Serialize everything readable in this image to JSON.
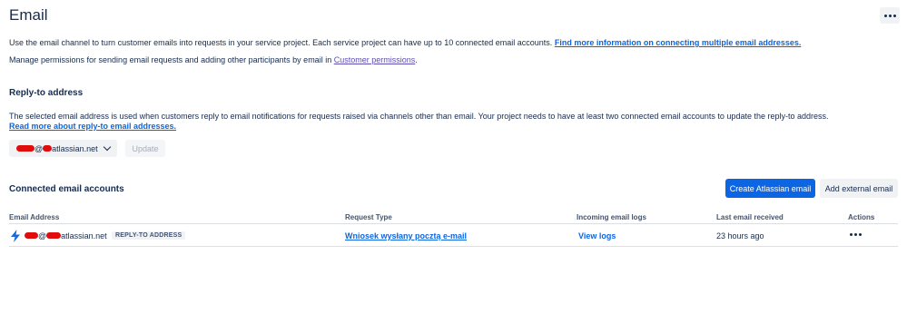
{
  "header": {
    "title": "Email"
  },
  "intro": {
    "line1_text": "Use the email channel to turn customer emails into requests in your service project. Each service project can have up to 10 connected email accounts.",
    "line1_link": "Find more information on connecting multiple email addresses.",
    "line2_text": "Manage permissions for sending email requests and adding other participants by email in",
    "line2_link": "Customer permissions",
    "line2_end": "."
  },
  "reply_to": {
    "heading": "Reply-to address",
    "description": "The selected email address is used when customers reply to email notifications for requests raised via channels other than email. Your project needs to have at least two connected email accounts to update the reply-to address.",
    "learn_more": "Read more about reply-to email addresses.",
    "selected_email_visible": "atlassian.net",
    "at_sign": "@",
    "update_label": "Update"
  },
  "accounts": {
    "heading": "Connected email accounts",
    "create_label": "Create Atlassian email",
    "add_external_label": "Add external email",
    "columns": [
      "Email Address",
      "Request Type",
      "Incoming email logs",
      "Last email received",
      "Actions"
    ],
    "rows": [
      {
        "email_visible": "atlassian.net",
        "at_sign": "@",
        "badge": "REPLY-TO ADDRESS",
        "request_type": "Wniosek wysłany pocztą e-mail",
        "logs": "View logs",
        "last_received": "23 hours ago"
      }
    ]
  },
  "colors": {
    "primary": "#0c66e4",
    "text": "#172b4d",
    "redaction": "#e00d0d"
  },
  "icons": [
    "more-horizontal-icon",
    "chevron-down-icon",
    "lightning-bolt-icon"
  ]
}
